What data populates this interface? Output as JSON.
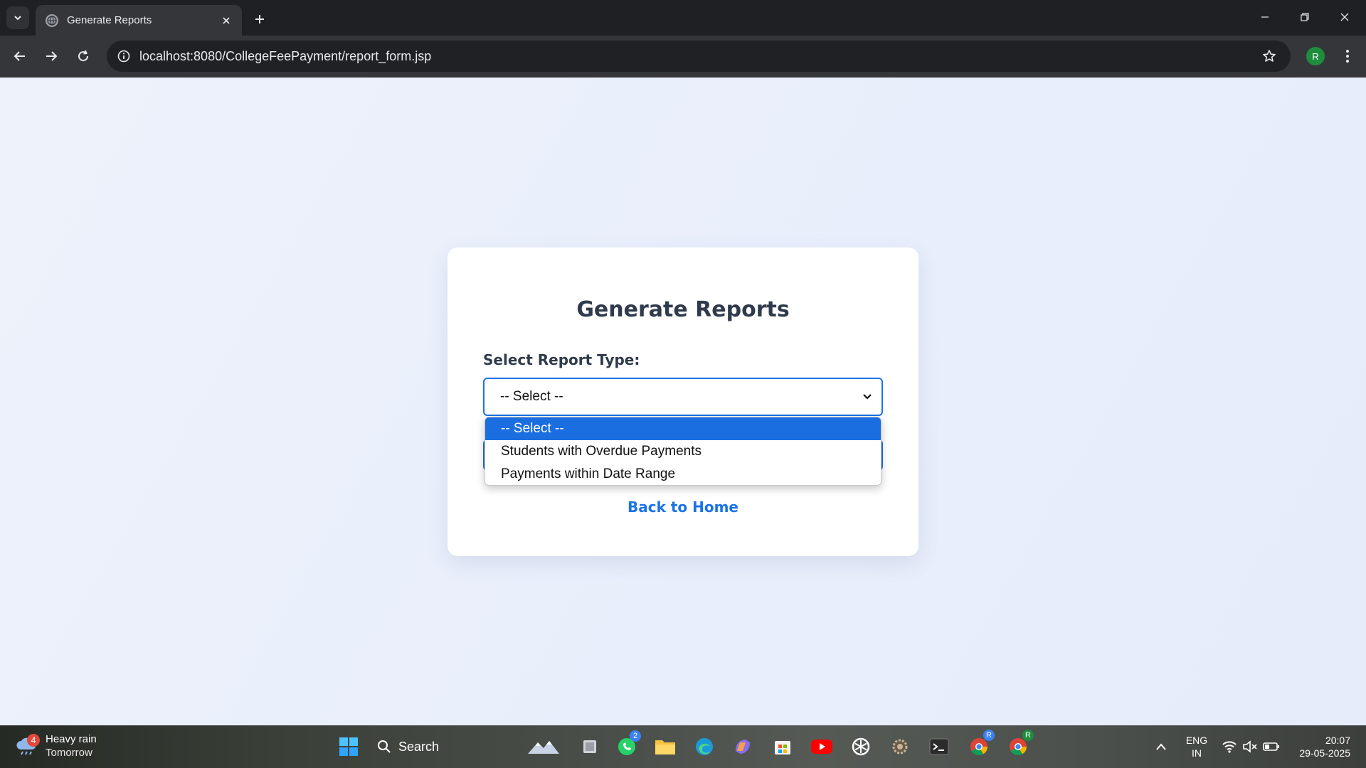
{
  "browser": {
    "tab_title": "Generate Reports",
    "url": "localhost:8080/CollegeFeePayment/report_form.jsp",
    "profile_initial": "R"
  },
  "page": {
    "title": "Generate Reports",
    "select_label": "Select Report Type:",
    "select_value": "-- Select --",
    "back_link": "Back to Home",
    "accent_color": "#1a73e8"
  },
  "dropdown": {
    "options": [
      {
        "label": "-- Select --",
        "selected": true
      },
      {
        "label": "Students with Overdue Payments",
        "selected": false
      },
      {
        "label": "Payments within Date Range",
        "selected": false
      }
    ]
  },
  "taskbar": {
    "weather_badge": "4",
    "weather_line1": "Heavy rain",
    "weather_line2": "Tomorrow",
    "search_label": "Search",
    "whatsapp_badge": "2",
    "language_line1": "ENG",
    "language_line2": "IN",
    "time": "20:07",
    "date": "29-05-2025"
  }
}
